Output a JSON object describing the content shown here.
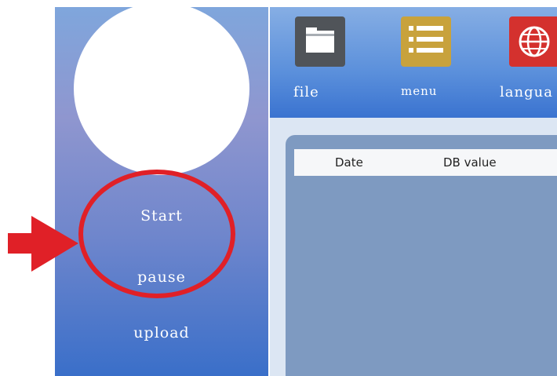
{
  "sidebar": {
    "buttons": {
      "start": "Start",
      "pause": "pause",
      "upload": "upload"
    }
  },
  "toolbar": {
    "items": [
      {
        "label": "file",
        "icon": "folder-icon"
      },
      {
        "label": "menu",
        "icon": "list-icon"
      },
      {
        "label": "langua",
        "icon": "globe-icon"
      }
    ]
  },
  "table": {
    "columns": [
      "Date",
      "DB value"
    ]
  },
  "annotation": {
    "color": "#e02027",
    "items": [
      "red-arrow",
      "red-circle"
    ]
  }
}
